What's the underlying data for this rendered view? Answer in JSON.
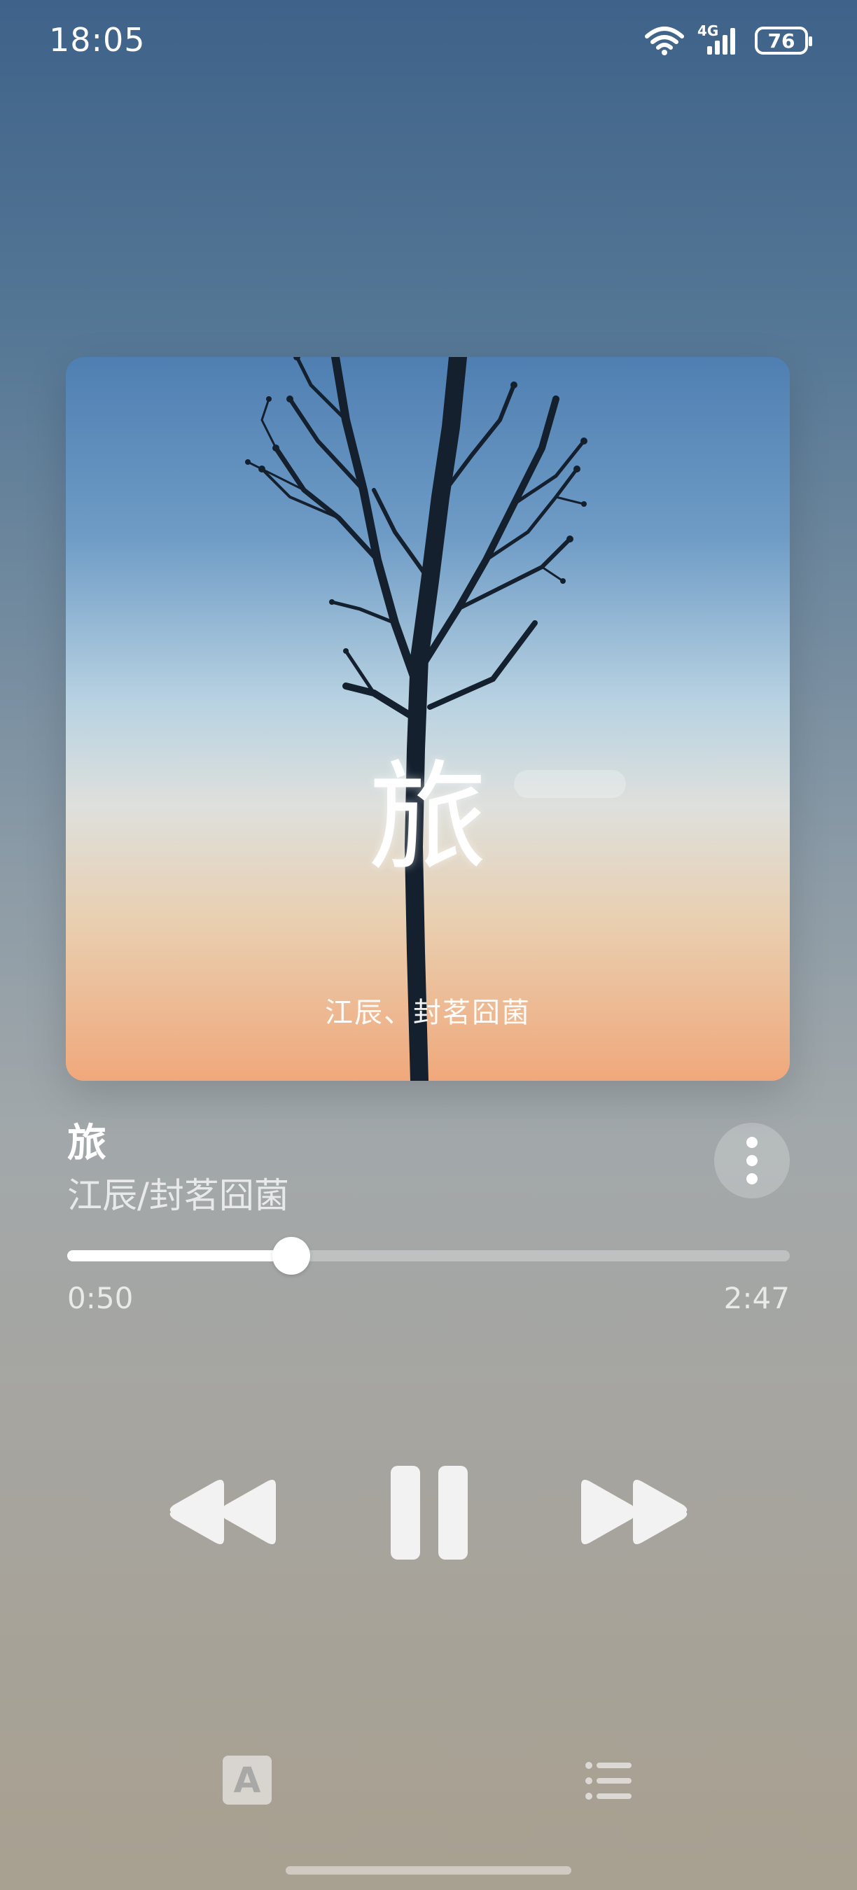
{
  "status_bar": {
    "time": "18:05",
    "network": "4G",
    "battery": "76"
  },
  "cover": {
    "title": "旅",
    "artists": "江辰、封茗囧菌"
  },
  "song": {
    "title": "旅",
    "artist": "江辰/封茗囧菌"
  },
  "playback": {
    "elapsed": "0:50",
    "total": "2:47",
    "progress": 0.31,
    "state": "playing"
  },
  "bottom": {
    "lyrics_icon_letter": "A"
  },
  "colors": {
    "accent": "#ffffff",
    "background_top": "#3e6289",
    "background_bottom": "#a8a090"
  }
}
